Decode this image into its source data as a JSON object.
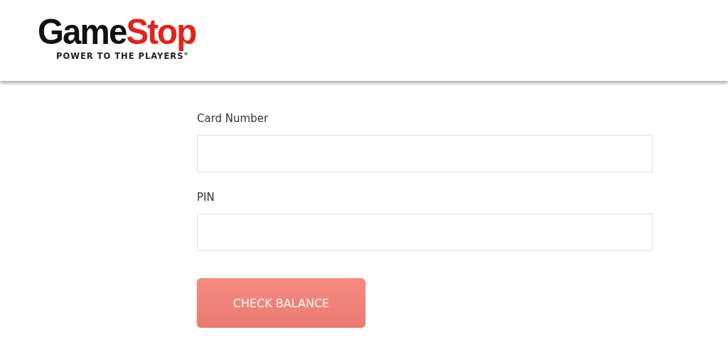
{
  "header": {
    "logo": {
      "parts": [
        "Game",
        "Stop"
      ],
      "tagline": "POWER TO THE PLAYERS$^{®}$"
    }
  },
  "form": {
    "fields": [
      {
        "label": "Card Number"
      },
      {
        "label": "PIN"
      }
    ],
    "button": "CHECK BALANCE"
  }
}
